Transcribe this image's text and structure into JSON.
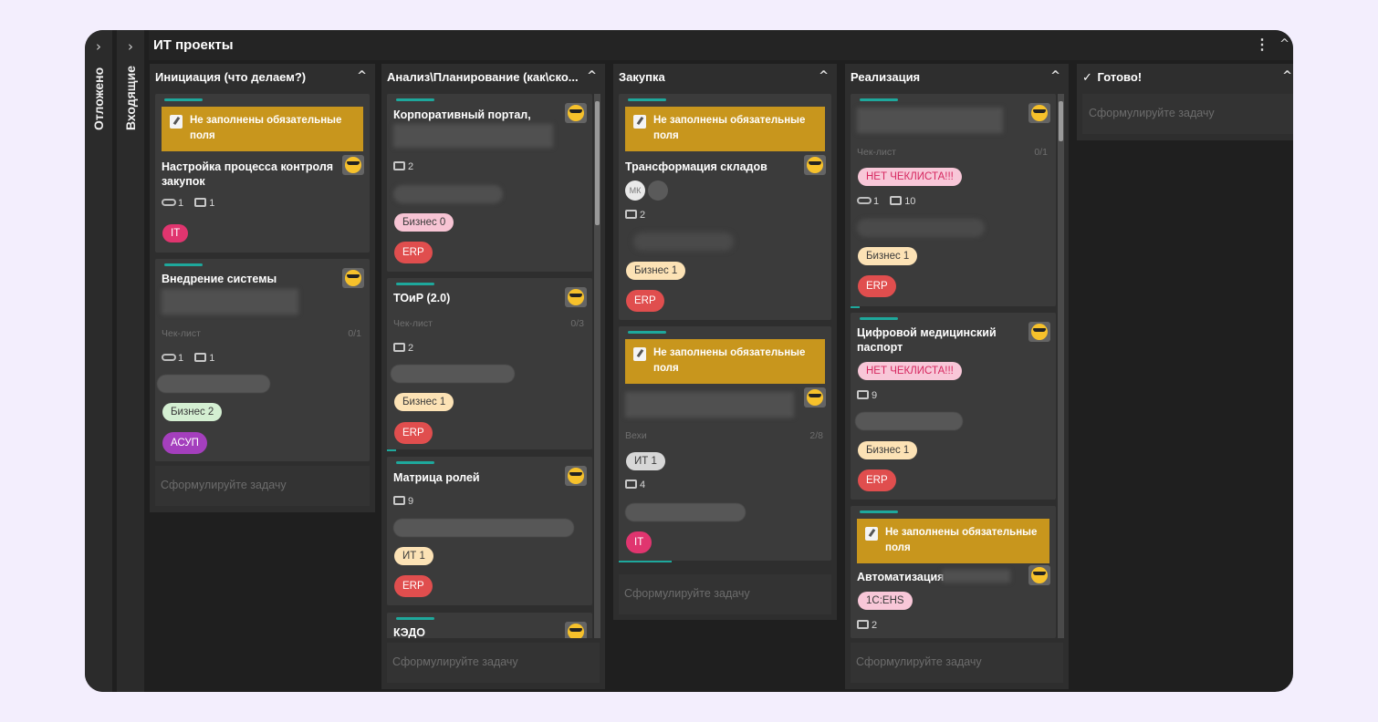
{
  "sidebar": {
    "postponed": "Отложено",
    "inbox": "Входящие",
    "expand_glyph": "›"
  },
  "header": {
    "title": "ИТ проекты",
    "menu_glyph": "⋮",
    "collapse_glyph": "^"
  },
  "colors": {
    "teal": "#1ea89c",
    "warning": "#c8961d",
    "background": "#1f1f1f"
  },
  "warning_text": "Не заполнены обязательные поля",
  "add_task_placeholder": "Сформулируйте задачу",
  "columns": [
    {
      "title": "Инициация (что делаем?)"
    },
    {
      "title": "Анализ\\Планирование (как\\ско..."
    },
    {
      "title": "Закупка"
    },
    {
      "title": "Реализация"
    },
    {
      "title": "Готово!",
      "check": "✓"
    }
  ],
  "col1": {
    "c1": {
      "title": "Настройка процесса контроля закупок",
      "attachments": "1",
      "comments": "1",
      "tag": "IT"
    },
    "c2": {
      "title": "Внедрение системы",
      "checklist_label": "Чек-лист",
      "checklist_count": "0/1",
      "attachments": "1",
      "comments": "1",
      "tags": [
        "Бизнес 2",
        "АСУП"
      ]
    }
  },
  "col2": {
    "c1": {
      "title": "Корпоративный портал,",
      "comments": "2",
      "tags": [
        "Бизнес 0",
        "ERP"
      ]
    },
    "c2": {
      "title": "ТОиР (2.0)",
      "checklist_label": "Чек-лист",
      "checklist_count": "0/3",
      "comments": "2",
      "tags": [
        "Бизнес 1",
        "ERP"
      ]
    },
    "c3": {
      "title": "Матрица ролей",
      "comments": "9",
      "tags": [
        "ИТ 1",
        "ERP"
      ]
    },
    "c4": {
      "title": "КЭДО"
    }
  },
  "col3": {
    "c1": {
      "title": "Трансформация складов",
      "avatar": "МК",
      "comments": "2",
      "tags": [
        "Бизнес 1",
        "ERP"
      ]
    },
    "c2": {
      "checklist_label": "Вехи",
      "checklist_count": "2/8",
      "tag_top": "ИТ 1",
      "comments": "4",
      "tag": "IT"
    }
  },
  "col4": {
    "c1": {
      "checklist_label": "Чек-лист",
      "checklist_count": "0/1",
      "no_checklist": "НЕТ ЧЕКЛИСТА!!!",
      "attachments": "1",
      "comments": "10",
      "tags": [
        "Бизнес 1",
        "ERP"
      ]
    },
    "c2": {
      "title": "Цифровой медицинский паспорт",
      "no_checklist": "НЕТ ЧЕКЛИСТА!!!",
      "comments": "9",
      "tags": [
        "Бизнес 1",
        "ERP"
      ]
    },
    "c3": {
      "title": "Автоматизация",
      "tag": "1С:EHS",
      "comments": "2"
    }
  }
}
